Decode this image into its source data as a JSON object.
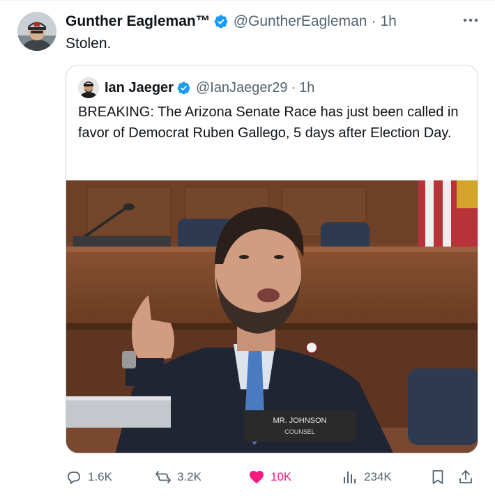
{
  "tweet": {
    "author": {
      "display_name": "Gunther Eagleman™",
      "handle": "@GuntherEagleman",
      "time": "1h",
      "separator": "·"
    },
    "text": "Stolen.",
    "quoted": {
      "author": {
        "display_name": "Ian Jaeger",
        "handle": "@IanJaeger29",
        "time": "1h",
        "separator": "·"
      },
      "text": "BREAKING: The Arizona Senate Race has just been called in favor of Democrat Ruben Gallego, 5 days after Election Day.",
      "media": {
        "nameplate_line1": "MR. JOHNSON",
        "nameplate_line2": "COUNSEL"
      }
    },
    "stats": {
      "replies": "1.6K",
      "reposts": "3.2K",
      "likes": "10K",
      "views": "234K"
    },
    "colors": {
      "verified": "#1d9bf0",
      "like": "#f91880",
      "secondary_text": "#536471",
      "border": "#cfd9de"
    },
    "icons": {
      "reply": "speech-bubble",
      "repost": "arrows-cycle",
      "like": "heart-filled",
      "views": "bar-chart",
      "bookmark": "bookmark",
      "share": "upload-arrow",
      "more": "three-dots",
      "verified": "badge-check"
    }
  }
}
